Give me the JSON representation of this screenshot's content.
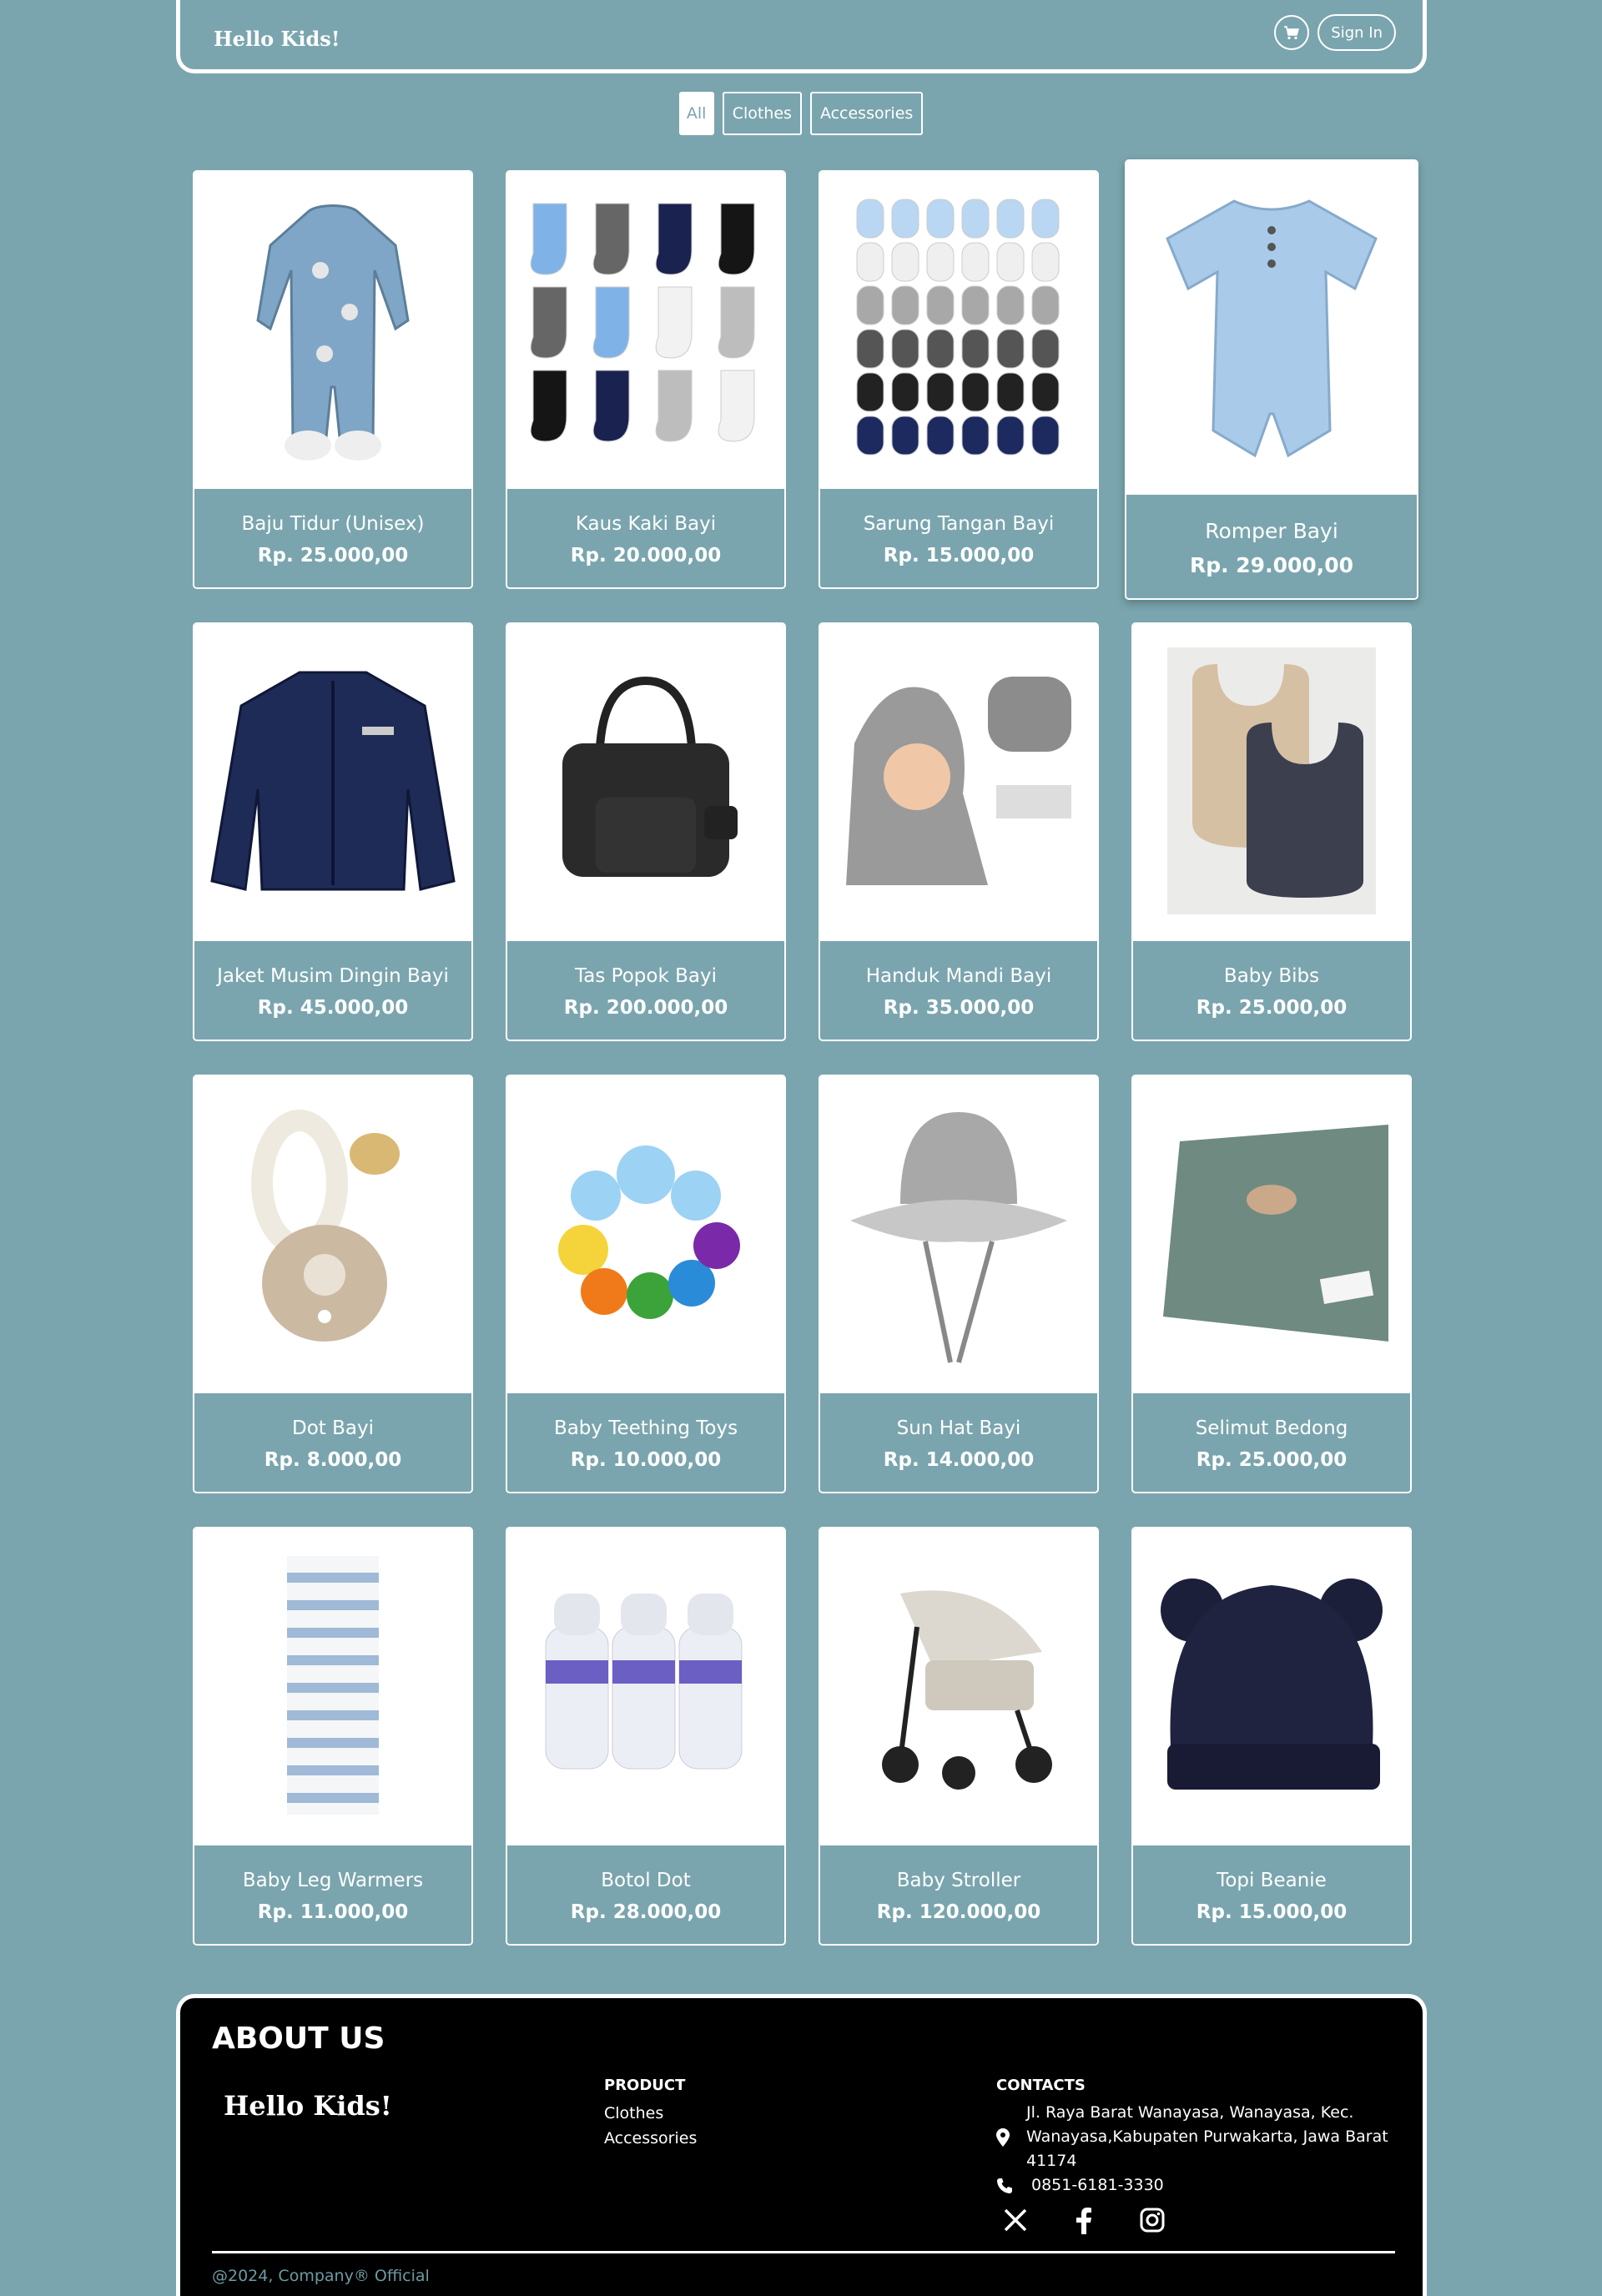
{
  "navbar": {
    "brand": "Hello Kids!",
    "signin_label": "Sign In",
    "cart_icon": "cart-icon"
  },
  "filters": [
    {
      "label": "All",
      "active": true
    },
    {
      "label": "Clothes",
      "active": false
    },
    {
      "label": "Accessories",
      "active": false
    }
  ],
  "products": [
    {
      "name": "Baju Tidur (Unisex)",
      "price": "Rp. 25.000,00",
      "icon": "sleepsuit-icon"
    },
    {
      "name": "Kaus Kaki Bayi",
      "price": "Rp. 20.000,00",
      "icon": "socks-icon"
    },
    {
      "name": "Sarung Tangan Bayi",
      "price": "Rp. 15.000,00",
      "icon": "mittens-icon"
    },
    {
      "name": "Romper Bayi",
      "price": "Rp. 29.000,00",
      "icon": "romper-icon"
    },
    {
      "name": "Jaket Musim Dingin Bayi",
      "price": "Rp. 45.000,00",
      "icon": "jacket-icon"
    },
    {
      "name": "Tas Popok Bayi",
      "price": "Rp. 200.000,00",
      "icon": "diaper-bag-icon"
    },
    {
      "name": "Handuk Mandi Bayi",
      "price": "Rp. 35.000,00",
      "icon": "hooded-towel-icon"
    },
    {
      "name": "Baby Bibs",
      "price": "Rp. 25.000,00",
      "icon": "bibs-icon"
    },
    {
      "name": "Dot Bayi",
      "price": "Rp. 8.000,00",
      "icon": "pacifier-icon"
    },
    {
      "name": "Baby Teething Toys",
      "price": "Rp. 10.000,00",
      "icon": "teething-toy-icon"
    },
    {
      "name": "Sun Hat Bayi",
      "price": "Rp. 14.000,00",
      "icon": "sun-hat-icon"
    },
    {
      "name": "Selimut Bedong",
      "price": "Rp. 25.000,00",
      "icon": "blanket-icon"
    },
    {
      "name": "Baby Leg Warmers",
      "price": "Rp. 11.000,00",
      "icon": "leg-warmers-icon"
    },
    {
      "name": "Botol Dot",
      "price": "Rp. 28.000,00",
      "icon": "bottles-icon"
    },
    {
      "name": "Baby Stroller",
      "price": "Rp. 120.000,00",
      "icon": "stroller-icon"
    },
    {
      "name": "Topi Beanie",
      "price": "Rp. 15.000,00",
      "icon": "beanie-icon"
    }
  ],
  "footer": {
    "about_title": "ABOUT US",
    "brand": "Hello Kids!",
    "product_title": "PRODUCT",
    "product_links": [
      "Clothes",
      "Accessories"
    ],
    "contacts_title": "CONTACTS",
    "address_lines": [
      "Jl. Raya Barat Wanayasa, Wanayasa, Kec.",
      "Wanayasa,Kabupaten Purwakarta, Jawa Barat",
      "41174"
    ],
    "phone": "0851-6181-3330",
    "socials": [
      "x-icon",
      "facebook-icon",
      "instagram-icon"
    ],
    "copyright": "@2024, Company® Official"
  },
  "colors": {
    "background": "#7aa5ae",
    "footer": "#000000",
    "card_image_bg": "#ffffff"
  }
}
